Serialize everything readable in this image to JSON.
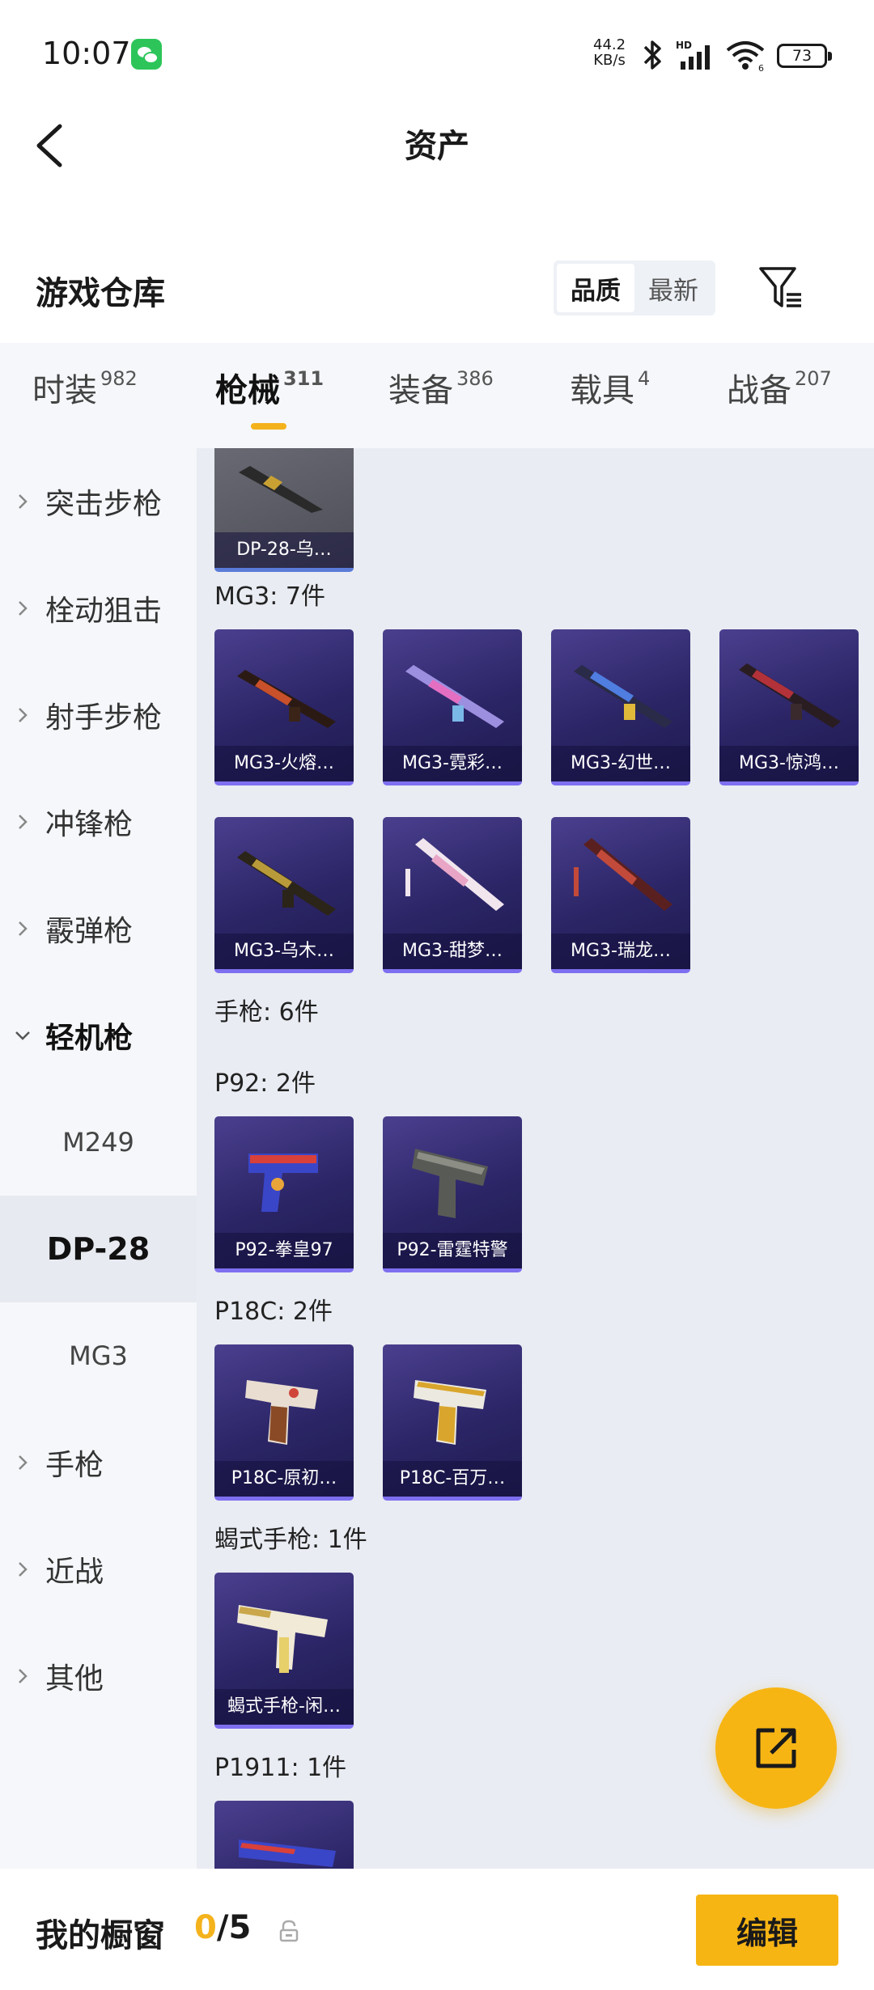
{
  "status_bar": {
    "time": "10:07",
    "net_speed_value": "44.2",
    "net_speed_unit": "KB/s",
    "battery": "73",
    "icons": [
      "wechat-icon",
      "bluetooth-icon",
      "signal-icon",
      "wifi-icon",
      "battery-icon"
    ]
  },
  "header": {
    "title": "资产"
  },
  "section": {
    "title": "游戏仓库",
    "sort_options": [
      "品质",
      "最新"
    ],
    "sort_selected": "品质"
  },
  "tabs": [
    {
      "label": "时装",
      "count": "982"
    },
    {
      "label": "枪械",
      "count": "311",
      "active": true
    },
    {
      "label": "装备",
      "count": "386"
    },
    {
      "label": "载具",
      "count": "4"
    },
    {
      "label": "战备",
      "count": "207"
    }
  ],
  "sidebar": {
    "items": [
      "突击步枪",
      "栓动狙击",
      "射手步枪",
      "冲锋枪",
      "霰弹枪",
      "轻机枪",
      "手枪",
      "近战",
      "其他"
    ],
    "expanded": "轻机枪",
    "sub_items": [
      "M249",
      "DP-28",
      "MG3"
    ],
    "selected_sub": "DP-28"
  },
  "content": {
    "top_card": "DP-28-乌…",
    "groups": [
      {
        "label": "MG3: 7件",
        "cards": [
          "MG3-火熔…",
          "MG3-霓彩…",
          "MG3-幻世…",
          "MG3-惊鸿…",
          "MG3-乌木…",
          "MG3-甜梦…",
          "MG3-瑞龙…"
        ]
      },
      {
        "label": "手枪: 6件",
        "cards": []
      },
      {
        "label": "P92: 2件",
        "cards": [
          "P92-拳皇97",
          "P92-雷霆特警"
        ]
      },
      {
        "label": "P18C: 2件",
        "cards": [
          "P18C-原初…",
          "P18C-百万…"
        ]
      },
      {
        "label": "蝎式手枪: 1件",
        "cards": [
          "蝎式手枪-闲…"
        ]
      },
      {
        "label": "P1911: 1件",
        "cards": []
      }
    ]
  },
  "bottom_bar": {
    "label": "我的橱窗",
    "current": "0",
    "total": "/5",
    "edit_label": "编辑"
  },
  "colors": {
    "accent": "#f7b514",
    "card_bg": "#2b2566",
    "sidebar_bg": "#f5f7fa",
    "content_bg": "#e9ecf2"
  }
}
